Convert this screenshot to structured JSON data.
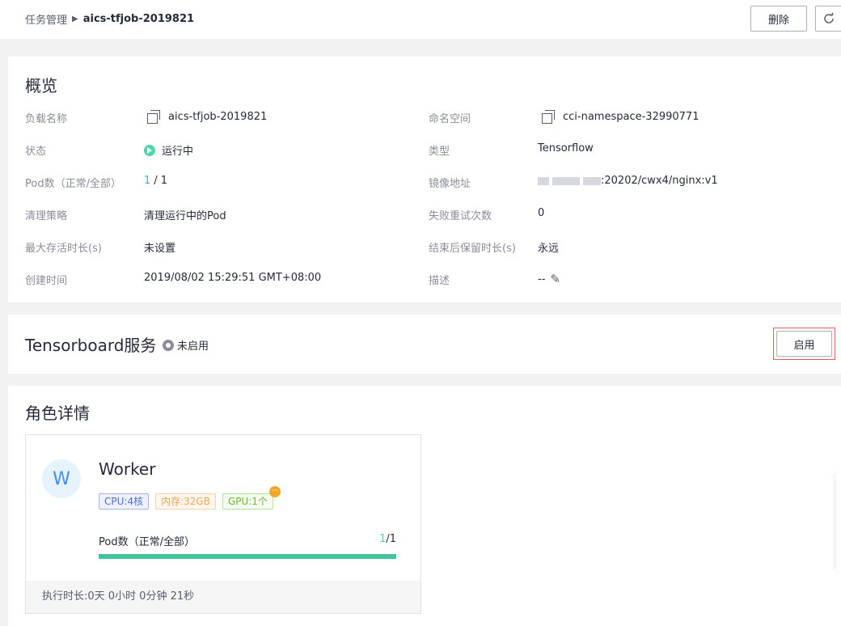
{
  "breadcrumb": {
    "parent": "任务管理",
    "current": "aics-tfjob-2019821"
  },
  "toolbar": {
    "delete_label": "删除",
    "refresh_icon": "refresh-icon"
  },
  "overview": {
    "title": "概览",
    "left": [
      {
        "label": "负载名称",
        "value": "aics-tfjob-2019821"
      },
      {
        "label": "状态",
        "value": "运行中"
      },
      {
        "label": "Pod数（正常/全部）",
        "value_ok": "1",
        "value_total": "/ 1"
      },
      {
        "label": "清理策略",
        "value": "清理运行中的Pod"
      },
      {
        "label": "最大存活时长(s)",
        "value": "未设置"
      },
      {
        "label": "创建时间",
        "value": "2019/08/02 15:29:51 GMT+08:00"
      }
    ],
    "right": [
      {
        "label": "命名空间",
        "value": "cci-namespace-32990771"
      },
      {
        "label": "类型",
        "value": "Tensorflow"
      },
      {
        "label": "镜像地址",
        "value": ":20202/cwx4/nginx:v1"
      },
      {
        "label": "失败重试次数",
        "value": "0"
      },
      {
        "label": "结束后保留时长(s)",
        "value": "永远"
      },
      {
        "label": "描述",
        "value": "--"
      }
    ]
  },
  "tensorboard": {
    "title": "Tensorboard服务",
    "status": "未启用",
    "enable_label": "启用"
  },
  "roles": {
    "title": "角色详情",
    "worker": {
      "avatar": "W",
      "name": "Worker",
      "tags": {
        "cpu": "CPU:4核",
        "mem": "内存:32GB",
        "gpu": "GPU:1个",
        "more": "···"
      },
      "pod_label": "Pod数（正常/全部）",
      "pod_ok": "1",
      "pod_total": "/1",
      "progress": 1.0,
      "duration": "执行时长:0天 0小时 0分钟 21秒"
    }
  },
  "colors": {
    "running": "#50d4ab",
    "progress": "#40c49e",
    "highlight": "#e65c5c"
  }
}
